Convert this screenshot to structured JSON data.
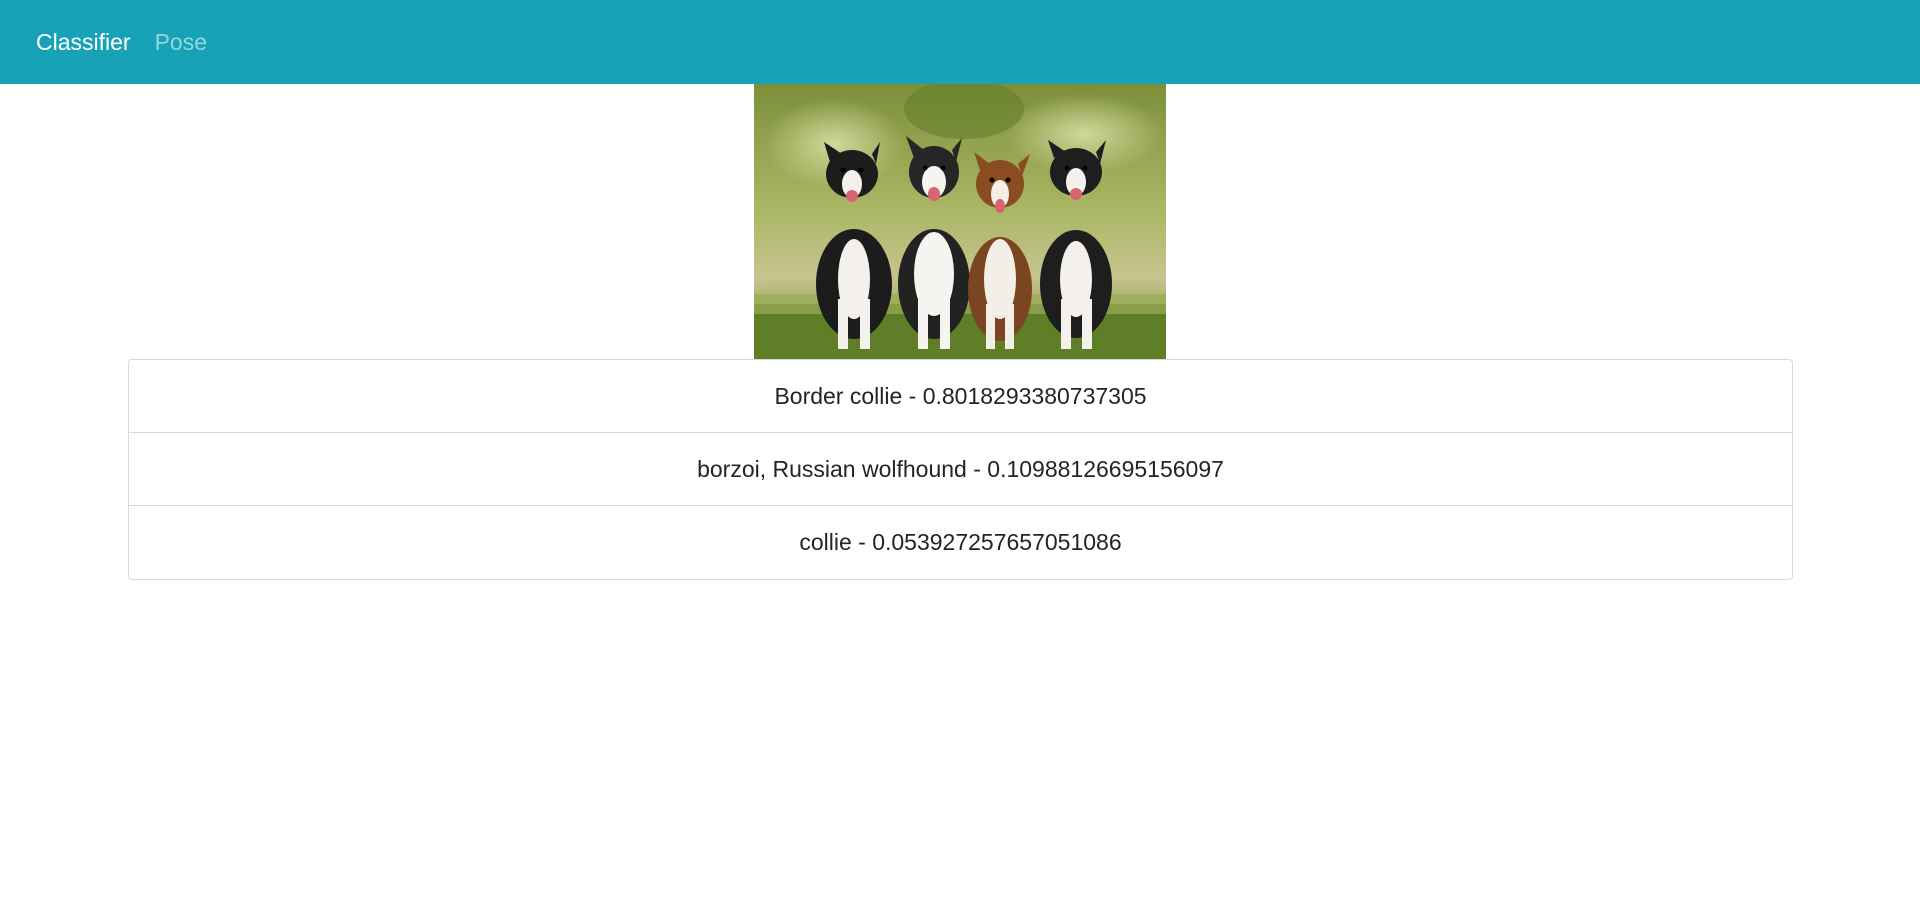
{
  "navbar": {
    "brand_label": "Classifier",
    "links": [
      {
        "label": "Pose"
      }
    ],
    "background_color": "#17a2b8"
  },
  "main": {
    "image": {
      "subject": "four border collie dogs sitting on grass in a park"
    },
    "results": [
      {
        "text": "Border collie - 0.8018293380737305"
      },
      {
        "text": "borzoi, Russian wolfhound - 0.10988126695156097"
      },
      {
        "text": "collie - 0.053927257657051086"
      }
    ]
  }
}
